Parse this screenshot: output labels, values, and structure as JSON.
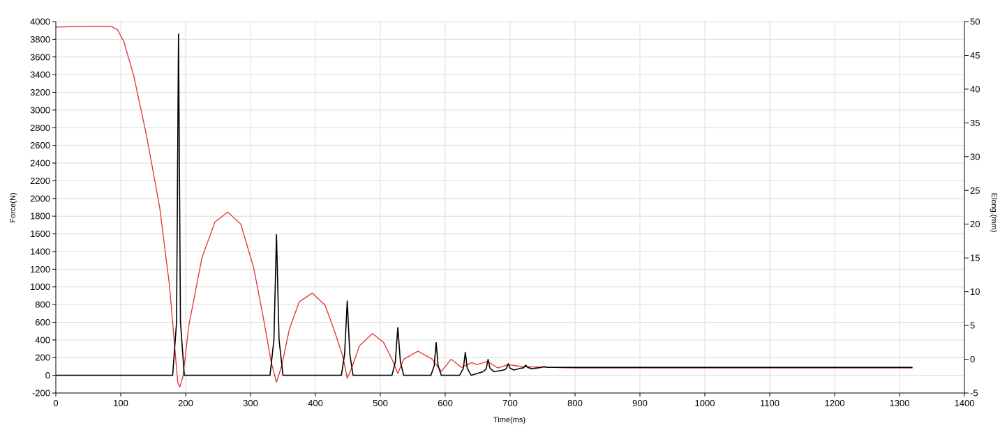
{
  "chart_data": {
    "type": "line",
    "title": "",
    "xlabel": "Time(ms)",
    "ylabel_left": "Force(N)",
    "ylabel_right": "Elong.(mm)",
    "xlim": [
      0,
      1400
    ],
    "ylim_left": [
      -200,
      4000
    ],
    "ylim_right": [
      -5,
      50
    ],
    "x_ticks": [
      "0",
      "100",
      "200",
      "300",
      "400",
      "500",
      "600",
      "700",
      "800",
      "900",
      "1000",
      "1100",
      "1200",
      "1300",
      "1400"
    ],
    "y_left_ticks": [
      "-200",
      "0",
      "200",
      "400",
      "600",
      "800",
      "1000",
      "1200",
      "1400",
      "1600",
      "1800",
      "2000",
      "2200",
      "2400",
      "2600",
      "2800",
      "3000",
      "3200",
      "3400",
      "3600",
      "3800",
      "4000"
    ],
    "y_right_ticks": [
      "-5",
      "0",
      "5",
      "10",
      "15",
      "20",
      "25",
      "30",
      "35",
      "40",
      "45",
      "50"
    ],
    "grid": true,
    "series": [
      {
        "axis": "left",
        "color": "#000000",
        "x": [
          0,
          180,
          186,
          189,
          192,
          198,
          330,
          336,
          340,
          344,
          350,
          440,
          445,
          449,
          453,
          458,
          518,
          523,
          527,
          531,
          536,
          578,
          583,
          586,
          589,
          594,
          622,
          628,
          631,
          634,
          640,
          658,
          663,
          666,
          669,
          675,
          690,
          694,
          697,
          700,
          706,
          716,
          721,
          724,
          727,
          733,
          744,
          749,
          752,
          755,
          760,
          1320
        ],
        "y": [
          0,
          0,
          600,
          3860,
          600,
          0,
          0,
          400,
          1590,
          400,
          0,
          0,
          240,
          840,
          240,
          0,
          0,
          150,
          540,
          150,
          0,
          0,
          110,
          370,
          110,
          0,
          0,
          80,
          260,
          80,
          0,
          40,
          70,
          180,
          80,
          40,
          60,
          75,
          130,
          80,
          60,
          80,
          85,
          115,
          90,
          75,
          85,
          90,
          100,
          92,
          90,
          90
        ]
      },
      {
        "axis": "right",
        "color": "#e03030",
        "x": [
          0,
          50,
          85,
          95,
          105,
          120,
          140,
          160,
          175,
          183,
          188,
          191,
          196,
          205,
          225,
          245,
          265,
          285,
          305,
          320,
          332,
          340,
          348,
          360,
          375,
          395,
          415,
          430,
          442,
          449,
          455,
          468,
          488,
          505,
          518,
          527,
          536,
          558,
          580,
          594,
          609,
          625,
          641,
          649,
          665,
          681,
          697,
          720,
          760,
          800,
          1320
        ],
        "y": [
          49.2,
          49.3,
          49.3,
          48.8,
          47,
          42,
          33,
          22.5,
          11,
          2,
          -3.5,
          -4.1,
          -2.5,
          5,
          15,
          20.3,
          21.8,
          20,
          13.5,
          6,
          -0.5,
          -3.4,
          -1,
          4.5,
          8.5,
          9.8,
          8,
          4,
          0.5,
          -2.8,
          -1.5,
          2,
          3.8,
          2.5,
          0,
          -2.1,
          0,
          1.2,
          0,
          -1.8,
          0,
          -1.2,
          -0.5,
          -0.8,
          -0.3,
          -1.3,
          -0.8,
          -1.1,
          -1.2,
          -1.3,
          -1.3
        ]
      }
    ]
  }
}
